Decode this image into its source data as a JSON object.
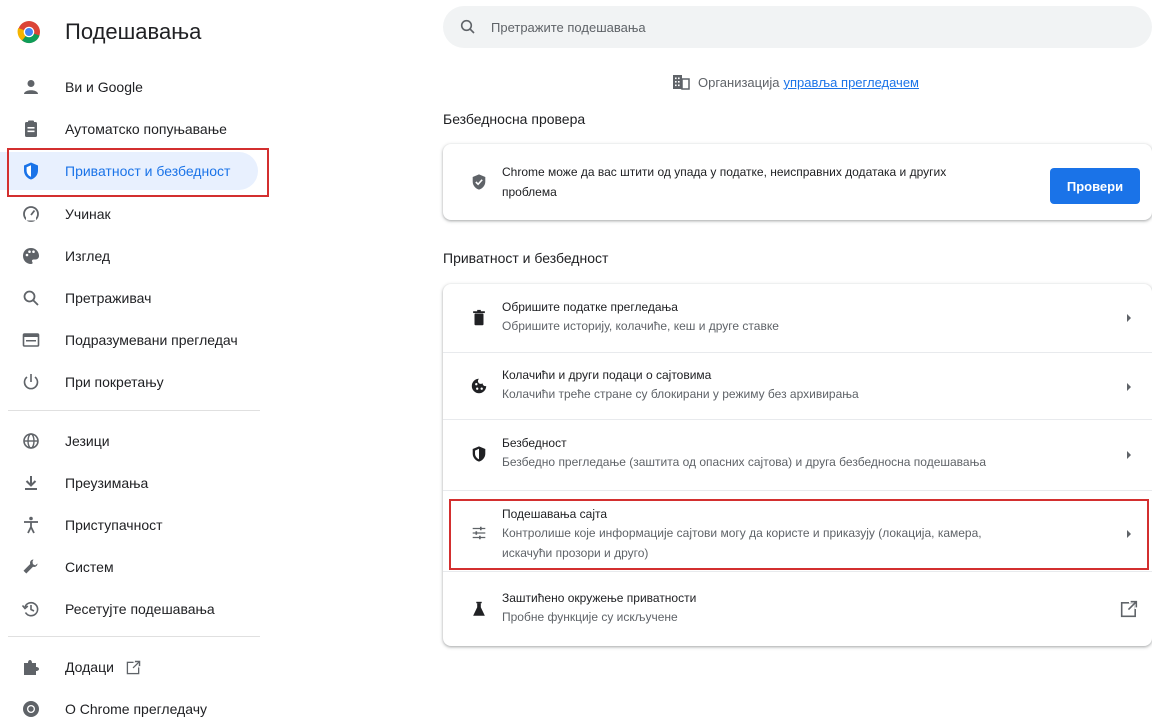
{
  "app": {
    "title": "Подешавања"
  },
  "search": {
    "placeholder": "Претражите подешавања"
  },
  "managed": {
    "text": "Организација",
    "link": "управља прегледачем"
  },
  "colors": {
    "accent": "#1a73e8",
    "highlight": "#d32f2f",
    "active_bg": "#e8f0fe"
  },
  "sidebar": {
    "items": [
      {
        "label": "Ви и Google",
        "icon": "person-icon"
      },
      {
        "label": "Аутоматско попуњавање",
        "icon": "clipboard-icon"
      },
      {
        "label": "Приватност и безбедност",
        "icon": "shield-icon",
        "active": true
      },
      {
        "label": "Учинак",
        "icon": "speedometer-icon"
      },
      {
        "label": "Изглед",
        "icon": "palette-icon"
      },
      {
        "label": "Претраживач",
        "icon": "search-icon"
      },
      {
        "label": "Подразумевани прегледач",
        "icon": "browser-icon"
      },
      {
        "label": "При покретању",
        "icon": "power-icon"
      },
      {
        "label": "Језици",
        "icon": "globe-icon"
      },
      {
        "label": "Преузимања",
        "icon": "download-icon"
      },
      {
        "label": "Приступачност",
        "icon": "accessibility-icon"
      },
      {
        "label": "Систем",
        "icon": "wrench-icon"
      },
      {
        "label": "Ресетујте подешавања",
        "icon": "restore-icon"
      },
      {
        "label": "Додаци",
        "icon": "puzzle-icon"
      },
      {
        "label": "О Chrome прегледачу",
        "icon": "chrome-icon"
      }
    ]
  },
  "safety_check": {
    "title": "Безбедносна провера",
    "text_line1": "Chrome може да вас штити од упада у податке, неисправних додатака и других",
    "text_line2": "проблема",
    "button": "Провери"
  },
  "privacy": {
    "title": "Приватност и безбедност",
    "rows": [
      {
        "primary": "Обришите податке прегледања",
        "secondary": "Обришите историју, колачиће, кеш и друге ставке",
        "icon": "trash-icon"
      },
      {
        "primary": "Колачићи и други подаци о сајтовима",
        "secondary": "Колачићи треће стране су блокирани у режиму без архивирања",
        "icon": "cookie-icon"
      },
      {
        "primary": "Безбедност",
        "secondary": "Безбедно прегледање (заштита од опасних сајтова) и друга безбедносна подешавања",
        "icon": "shield-icon"
      },
      {
        "primary": "Подешавања сајта",
        "secondary": "Контролише које информације сајтови могу да користе и приказују (локација, камера,",
        "secondary2": "искачући прозори и друго)",
        "icon": "sliders-icon"
      },
      {
        "primary": "Заштићено окружење приватности",
        "secondary": "Пробне функције су искључене",
        "icon": "flask-icon"
      }
    ]
  }
}
